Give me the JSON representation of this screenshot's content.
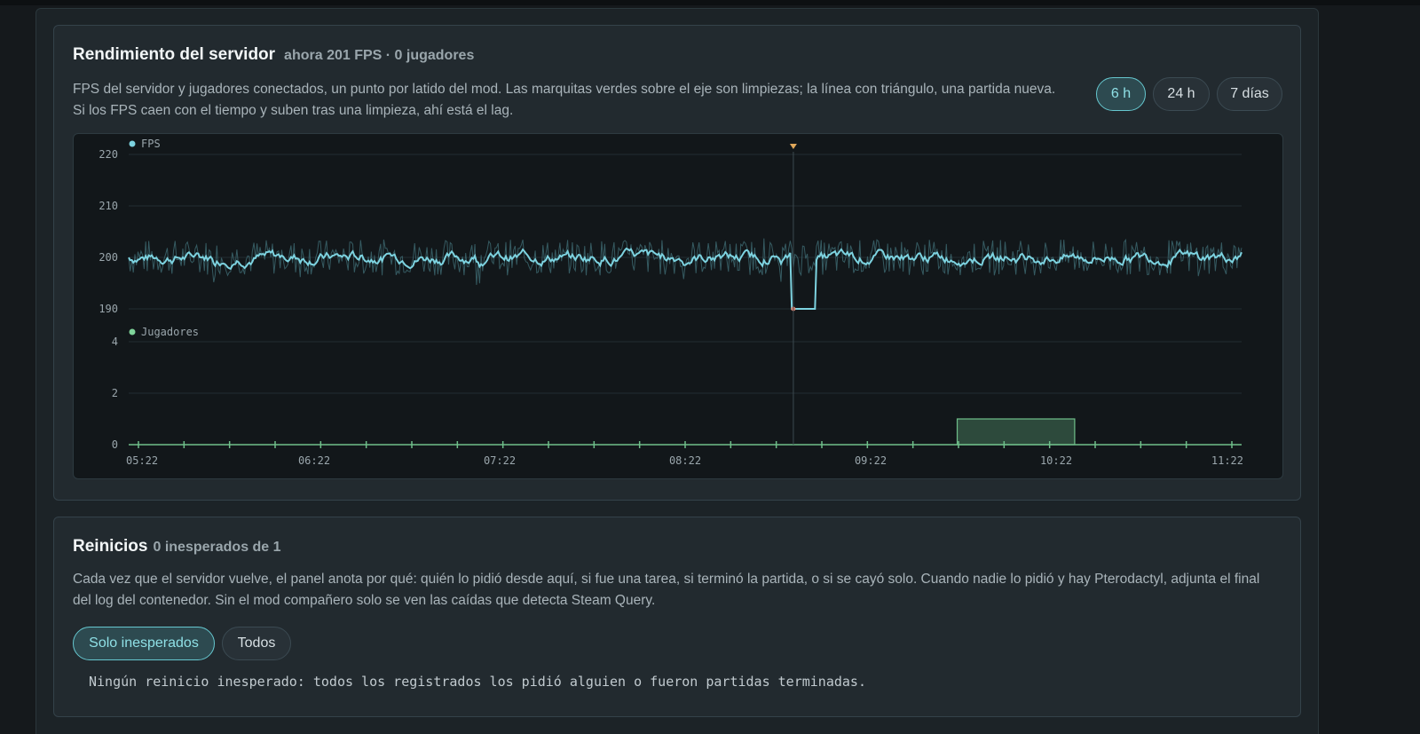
{
  "performance": {
    "title": "Rendimiento del servidor",
    "subtitle": "ahora 201 FPS · 0 jugadores",
    "description_line1": "FPS del servidor y jugadores conectados, un punto por latido del mod. Las marquitas verdes sobre el eje son limpiezas; la línea con triángulo, una partida nueva.",
    "description_line2": "Si los FPS caen con el tiempo y suben tras una limpieza, ahí está el lag.",
    "ranges": [
      {
        "label": "6 h",
        "active": true
      },
      {
        "label": "24 h",
        "active": false
      },
      {
        "label": "7 días",
        "active": false
      }
    ]
  },
  "chart_data": {
    "type": "line",
    "fps_series": {
      "name": "FPS",
      "color": "#7dd3e0",
      "ylim": [
        190,
        220
      ],
      "yticks": [
        190,
        200,
        210,
        220
      ],
      "baseline": 200,
      "dip": {
        "time": "08:57",
        "value": 190
      },
      "values_note_points": [
        [
          "05:22",
          200
        ],
        [
          "06:22",
          200
        ],
        [
          "07:22",
          200
        ],
        [
          "08:22",
          200
        ],
        [
          "08:57",
          190
        ],
        [
          "09:00",
          200
        ],
        [
          "09:22",
          200
        ],
        [
          "10:22",
          200
        ],
        [
          "11:22",
          201
        ]
      ]
    },
    "players_series": {
      "name": "Jugadores",
      "color": "#7fd49a",
      "ylim": [
        0,
        4
      ],
      "yticks": [
        0,
        2,
        4
      ],
      "segments": [
        {
          "start": "09:50",
          "end": "10:28",
          "value": 1
        }
      ]
    },
    "x_ticks": [
      "05:22",
      "06:22",
      "07:22",
      "08:22",
      "09:22",
      "10:22",
      "11:22"
    ],
    "x_range_minutes": [
      0,
      360
    ],
    "new_match_marker": "08:57",
    "cleanup_marks_count": 25
  },
  "restarts": {
    "title": "Reinicios",
    "subtitle": "0 inesperados de 1",
    "description_line1": "Cada vez que el servidor vuelve, el panel anota por qué: quién lo pidió desde aquí, si fue una tarea, si terminó la partida, o si se cayó solo. Cuando nadie lo pidió y hay Pterodactyl, adjunta el final",
    "description_line2": "del log del contenedor. Sin el mod compañero solo se ven las caídas que detecta Steam Query.",
    "filters": [
      {
        "label": "Solo inesperados",
        "active": true
      },
      {
        "label": "Todos",
        "active": false
      }
    ],
    "empty_message": "Ningún reinicio inesperado: todos los registrados los pidió alguien o fueron partidas terminadas."
  }
}
